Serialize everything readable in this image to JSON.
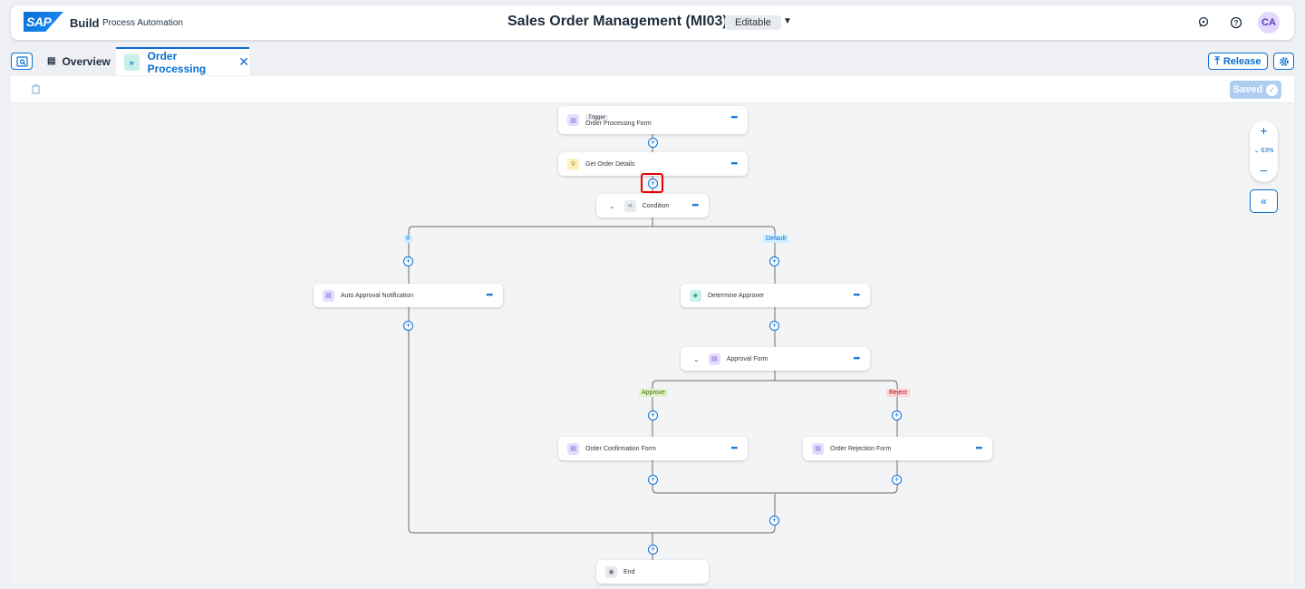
{
  "shell": {
    "logo": "SAP",
    "brand": "Build",
    "product": "Process Automation",
    "title": "Sales Order Management (MI03)",
    "status": "Editable",
    "user_initials": "CA",
    "icons": [
      "joule-icon",
      "help-icon"
    ]
  },
  "tabs": [
    {
      "label": "Overview",
      "icon": "overview-icon"
    },
    {
      "label": "Order Processing",
      "icon": "process-icon",
      "active": true
    }
  ],
  "actions": {
    "release": "Release",
    "saved": "Saved"
  },
  "zoom": {
    "level": "63%",
    "plus": "+",
    "minus": "–"
  },
  "nodes": {
    "trigger": {
      "tag": "Trigger",
      "name": "Order Processing Form"
    },
    "get_order": "Get Order Details",
    "condition": "Condition",
    "auto_approval": "Auto Approval Notification",
    "determine_approver": "Determine Approver",
    "approval_form": "Approval Form",
    "confirmation_form": "Order Confirmation Form",
    "rejection_form": "Order Rejection Form",
    "end": "End"
  },
  "branch_labels": {
    "if": "If",
    "default": "Default",
    "approve": "Approve",
    "reject": "Reject"
  },
  "more_glyph": "•••",
  "plus_glyph": "+"
}
